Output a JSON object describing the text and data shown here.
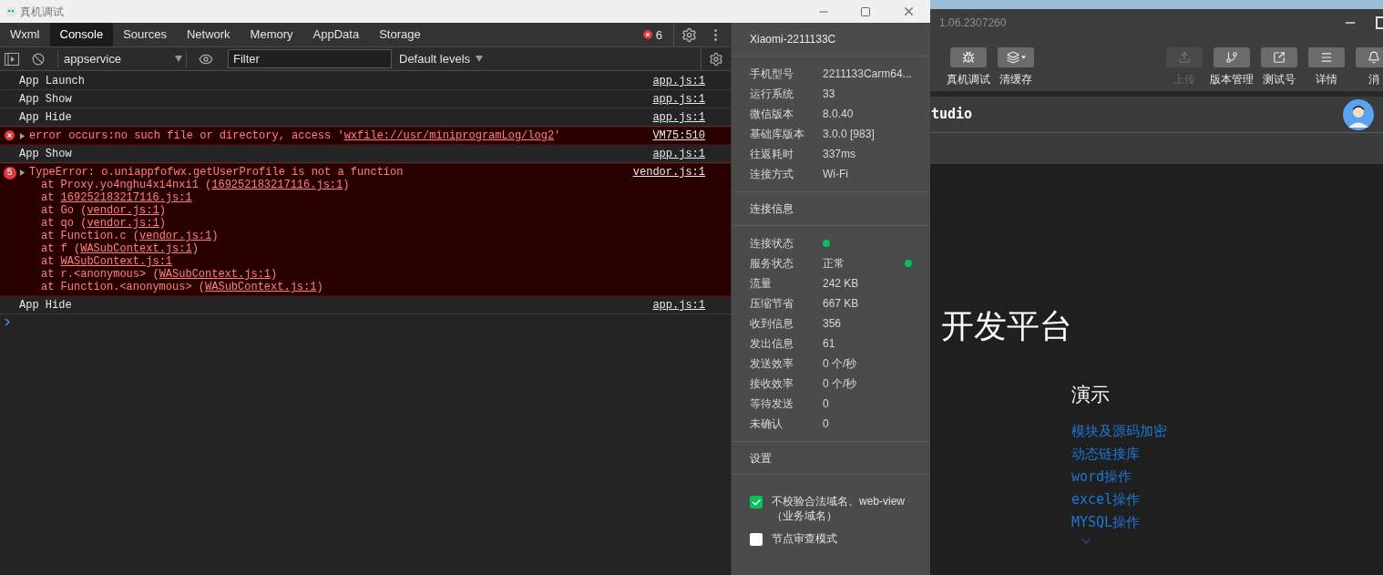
{
  "devtools_window": {
    "title": "真机调试"
  },
  "tabs": [
    {
      "label": "Wxml",
      "selected": false
    },
    {
      "label": "Console",
      "selected": true
    },
    {
      "label": "Sources",
      "selected": false
    },
    {
      "label": "Network",
      "selected": false
    },
    {
      "label": "Memory",
      "selected": false
    },
    {
      "label": "AppData",
      "selected": false
    },
    {
      "label": "Storage",
      "selected": false
    }
  ],
  "error_count": "6",
  "console_toolbar": {
    "context": "appservice",
    "filter_placeholder": "Filter",
    "levels": "Default levels"
  },
  "console": [
    {
      "kind": "log",
      "message": [
        {
          "text": "App Launch"
        }
      ],
      "source": "app.js:1"
    },
    {
      "kind": "log",
      "message": [
        {
          "text": "App Show"
        }
      ],
      "source": "app.js:1"
    },
    {
      "kind": "log",
      "message": [
        {
          "text": "App Hide"
        }
      ],
      "source": "app.js:1"
    },
    {
      "kind": "error",
      "expanded": false,
      "message": [
        {
          "text": "error occurs:no such file or directory, access '"
        },
        {
          "text": "wxfile://usr/miniprogramLog/log2",
          "link": true
        },
        {
          "text": "'"
        }
      ],
      "source": "VM75:510"
    },
    {
      "kind": "log",
      "message": [
        {
          "text": "App Show"
        }
      ],
      "source": "app.js:1"
    },
    {
      "kind": "error",
      "expanded": false,
      "repeat": "5",
      "message": [
        {
          "text": "TypeError: o.uniappfofwx.getUserProfile is not a function"
        }
      ],
      "source": "vendor.js:1",
      "stack": [
        [
          {
            "text": "at Proxy.yo4nghu4xi4nxi1 ("
          },
          {
            "text": "169252183217116.js:1",
            "link": true
          },
          {
            "text": ")"
          }
        ],
        [
          {
            "text": "at "
          },
          {
            "text": "169252183217116.js:1",
            "link": true
          }
        ],
        [
          {
            "text": "at Go ("
          },
          {
            "text": "vendor.js:1",
            "link": true
          },
          {
            "text": ")"
          }
        ],
        [
          {
            "text": "at qo ("
          },
          {
            "text": "vendor.js:1",
            "link": true
          },
          {
            "text": ")"
          }
        ],
        [
          {
            "text": "at Function.c ("
          },
          {
            "text": "vendor.js:1",
            "link": true
          },
          {
            "text": ")"
          }
        ],
        [
          {
            "text": "at f ("
          },
          {
            "text": "WASubContext.js:1",
            "link": true
          },
          {
            "text": ")"
          }
        ],
        [
          {
            "text": "at "
          },
          {
            "text": "WASubContext.js:1",
            "link": true
          }
        ],
        [
          {
            "text": "at r.<anonymous> ("
          },
          {
            "text": "WASubContext.js:1",
            "link": true
          },
          {
            "text": ")"
          }
        ],
        [
          {
            "text": "at Function.<anonymous> ("
          },
          {
            "text": "WASubContext.js:1",
            "link": true
          },
          {
            "text": ")"
          }
        ]
      ]
    },
    {
      "kind": "log",
      "message": [
        {
          "text": "App Hide"
        }
      ],
      "source": "app.js:1"
    }
  ],
  "device_panel": {
    "device_name": "Xiaomi-2211133C",
    "device_info": [
      {
        "label": "手机型号",
        "value": "2211133Carm64..."
      },
      {
        "label": "运行系统",
        "value": "33"
      },
      {
        "label": "微信版本",
        "value": "8.0.40"
      },
      {
        "label": "基础库版本",
        "value": "3.0.0 [983]"
      },
      {
        "label": "往返耗时",
        "value": "337ms"
      },
      {
        "label": "连接方式",
        "value": "Wi-Fi"
      }
    ],
    "connection_title": "连接信息",
    "connection_stats": [
      {
        "label": "连接状态",
        "dot": true
      },
      {
        "label": "服务状态",
        "value": "正常",
        "dot": true
      },
      {
        "label": "流量",
        "value": "242 KB"
      },
      {
        "label": "压缩节省",
        "value": "667 KB"
      },
      {
        "label": "收到信息",
        "value": "356"
      },
      {
        "label": "发出信息",
        "value": "61"
      },
      {
        "label": "发送效率",
        "value": "0 个/秒"
      },
      {
        "label": "接收效率",
        "value": "0 个/秒"
      },
      {
        "label": "等待发送",
        "value": "0"
      },
      {
        "label": "未确认",
        "value": "0"
      }
    ],
    "settings_title": "设置",
    "settings": [
      {
        "label": "不校验合法域名、web-view（业务域名）",
        "checked": true
      },
      {
        "label": "节点审查模式",
        "checked": false
      }
    ]
  },
  "ide": {
    "version": "1.06.2307260",
    "toolbar_left": [
      {
        "kind": "bug",
        "label": "真机调试",
        "disabled": false
      },
      {
        "kind": "layers",
        "label": "清缓存",
        "disabled": false
      }
    ],
    "toolbar_right": [
      {
        "kind": "upload",
        "label": "上传",
        "disabled": true
      },
      {
        "kind": "branch",
        "label": "版本管理",
        "disabled": false
      },
      {
        "kind": "external",
        "label": "测试号",
        "disabled": false
      },
      {
        "kind": "menu",
        "label": "详情",
        "disabled": false
      },
      {
        "kind": "bell",
        "label": "消",
        "disabled": false
      }
    ],
    "project": "tudio",
    "heading": "开发平台",
    "section": "演示",
    "links": [
      "模块及源码加密",
      "动态链接库",
      "word操作",
      "excel操作",
      "MYSQL操作"
    ]
  }
}
